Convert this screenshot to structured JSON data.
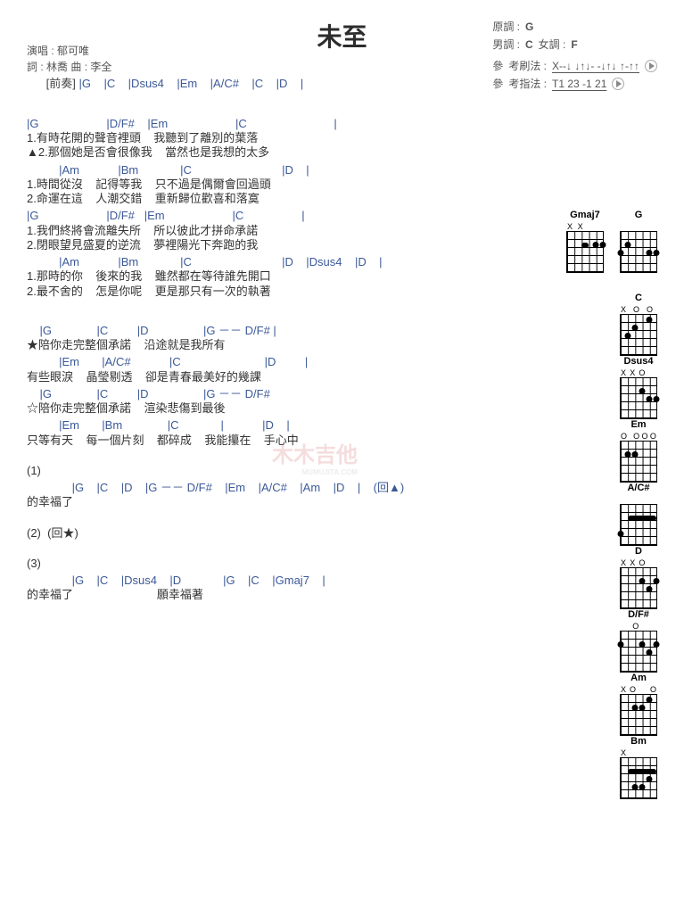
{
  "title": "未至",
  "meta": {
    "singer_label": "演唱 :",
    "singer": "郁可唯",
    "lyr_label": "詞 :",
    "lyr": "林喬",
    "comp_label": "曲 :",
    "comp": "李全",
    "orig_label": "原調 :",
    "orig": "G",
    "male_label": "男調 :",
    "male": "C",
    "female_label": "女調 :",
    "female": "F",
    "strum_label": "考刷法 :",
    "strum": "X--↓ ↓↑↓- -↓↑↓ ↑-↑↑",
    "pick_label": "考指法 :",
    "pick": "T1 23 -1 21"
  },
  "intro_label": "[前奏]",
  "intro": "|G    |C    |Dsus4    |Em    |A/C#    |C    |D    |",
  "v1": {
    "c1": "|G                     |D/F#    |Em                     |C                           |",
    "l1a": "1.有時花開的聲音裡頭    我聽到了離別的葉落",
    "l1b": "▲2.那個她是否會很像我    當然也是我想的太多",
    "c2": "          |Am            |Bm             |C                            |D    |",
    "l2a": "1.時間從沒    記得等我    只不過是偶爾會回過頭",
    "l2b": "2.命運在這    人潮交錯    重新歸位歡喜和落寞",
    "c3": "|G                     |D/F#   |Em                     |C                  |",
    "l3a": "1.我們終將會流離失所    所以彼此才拼命承諾",
    "l3b": "2.閉眼望見盛夏的逆流    夢裡陽光下奔跑的我",
    "c4": "          |Am            |Bm             |C                            |D    |Dsus4    |D    |",
    "l4a": "1.那時的你    後來的我    雖然都在等待誰先開口",
    "l4b": "2.最不舍的    怎是你呢    更是那只有一次的執著"
  },
  "ch": {
    "c1": "    |G              |C         |D                 |G －－ D/F# |",
    "l1": "★陪你走完整個承諾    沿途就是我所有",
    "c2": "          |Em       |A/C#            |C                          |D         |",
    "l2": "有些眼淚    晶瑩剔透    卻是青春最美好的幾課",
    "c3": "    |G              |C         |D                 |G －－ D/F#",
    "l3": "☆陪你走完整個承諾    渲染悲傷到最後",
    "c4": "          |Em       |Bm              |C             |            |D    |",
    "l4": "只等有天    每一個片刻    都碎成    我能攥在    手心中"
  },
  "out": {
    "s1": "(1)",
    "c1": "              |G    |C    |D    |G －－ D/F#    |Em    |A/C#    |Am    |D    |    (回▲)",
    "l1": "的幸福了",
    "s2": "(2)  (回★)",
    "s3": "(3)",
    "c3": "              |G    |C    |Dsus4    |D             |G    |C    |Gmaj7    |",
    "l3": "的幸福了                          願幸福著"
  },
  "chords": [
    "Gmaj7",
    "G",
    "C",
    "Dsus4",
    "Em",
    "A/C#",
    "D",
    "D/F#",
    "Am",
    "Bm"
  ]
}
